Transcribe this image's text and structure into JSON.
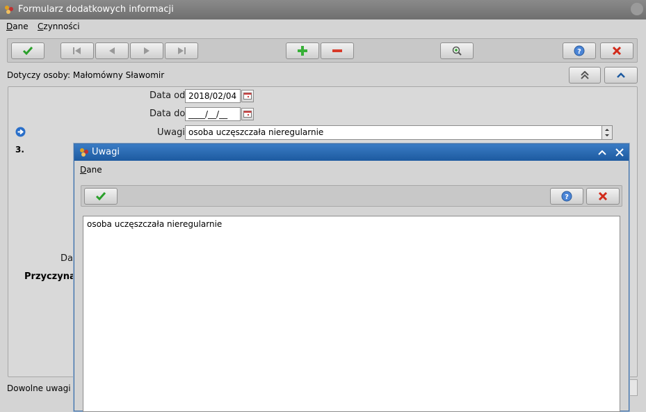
{
  "window": {
    "title": "Formularz dodatkowych informacji"
  },
  "menu": {
    "dane": "Dane",
    "czynnosci": "Czynności"
  },
  "toolbar": {
    "confirm_icon": "checkmark-icon",
    "first_icon": "first-record-icon",
    "prev_icon": "prev-record-icon",
    "next_icon": "next-record-icon",
    "last_icon": "last-record-icon",
    "add_icon": "plus-icon",
    "remove_icon": "minus-icon",
    "search_icon": "zoom-icon",
    "help_icon": "help-icon",
    "cancel_icon": "close-icon"
  },
  "person": {
    "label": "Dotyczy osoby:",
    "name": "Małomówny Sławomir"
  },
  "form": {
    "date_from_label": "Data od",
    "date_from_value": "2018/02/04",
    "date_to_label": "Data do",
    "date_to_value": "____/__/__",
    "notes_label": "Uwagi",
    "notes_value": "osoba uczęszczała nieregularnie",
    "row_number": "3.",
    "partial_label_dat": "Dat",
    "reason_label": "Przyczyna",
    "footer_text": "Dowolne uwagi o"
  },
  "dialog": {
    "title": "Uwagi",
    "menu_dane": "Dane",
    "text": "osoba uczęszczała nieregularnie"
  },
  "colors": {
    "accent_blue": "#1d5aa0",
    "confirm_green": "#2aa02a",
    "cancel_red": "#d12a1a",
    "add_green": "#38b038",
    "remove_red": "#d83a2a"
  }
}
